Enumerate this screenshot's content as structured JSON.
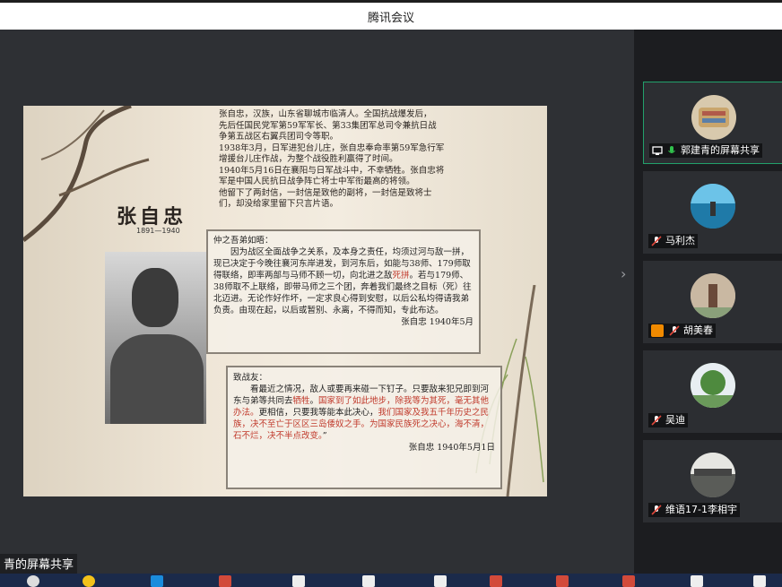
{
  "window": {
    "title": "腾讯会议"
  },
  "stage": {
    "share_label": "青的屏幕共享"
  },
  "slide": {
    "name": "张自忠",
    "dates": "1891—1940",
    "bio_lines": [
      "张自忠，汉族，山东省聊城市临清人。全国抗战爆发后，",
      "先后任国民党军第59军军长、第33集团军总司令兼抗日战",
      "争第五战区右翼兵团司令等职。",
      "1938年3月，日军进犯台儿庄，张自忠奉命率第59军急行军",
      "增援台儿庄作战，为整个战役胜利赢得了时间。",
      "1940年5月16日在襄阳与日军战斗中，不幸牺牲。张自忠将",
      "军是中国人民抗日战争阵亡将士中军衔最高的将领。",
      "他留下了两封信，一封信是致他的副将，一封信是致将士",
      "们，却没给家里留下只言片语。"
    ],
    "letter1": {
      "greeting": "仲之吾弟如晤：",
      "body_a": "因为战区全面战争之关系，及本身之责任，均须过河与敌一拼，现已决定于今晚往襄河东岸进发，到河东后，如能与38师、179师取得联络，即率两部与马师不顾一切，向北进之敌",
      "body_red": "死拼",
      "body_b": "。若与179师、38师取不上联络，即带马师之三个团，奔着我们最终之目标（死）往北迈进。无论作好作坏，一定求良心得到安慰，以后公私均得请我弟负责。由现在起，以后或暂别、永离，不得而知，专此布达。",
      "signature": "张自忠 1940年5月"
    },
    "letter2": {
      "greeting": "致战友：",
      "body_a": "看最近之情况，敌人或要再来碰一下钉子。只要敌来犯兄即到河东与弟等共同去",
      "body_red1": "牺牲",
      "body_b": "。",
      "body_red2": "国家到了如此地步，除我等为其死，毫无其他办法。",
      "body_c": "更相信，只要我等能本此决心，",
      "body_red3": "我们国家及我五千年历史之民族，决不至亡于区区三岛倭奴之手。为国家民族死之决心，海不清，石不烂，决不半点改变。",
      "body_d": "”",
      "signature": "张自忠 1940年5月1日"
    }
  },
  "participants": [
    {
      "name": "郭建青的屏幕共享",
      "active": true,
      "avatar_color": "#d8c9ad",
      "status_icons": [
        "screen-share-icon",
        "mic-on-icon"
      ]
    },
    {
      "name": "马利杰",
      "active": false,
      "avatar_color": "#2d8fb8",
      "status_icons": [
        "mic-muted-icon"
      ]
    },
    {
      "name": "胡美春",
      "active": false,
      "avatar_color": "#b7b0a3",
      "status_icons": [
        "user-badge-icon",
        "mic-muted-icon"
      ]
    },
    {
      "name": "吴迪",
      "active": false,
      "avatar_color": "#5f8f57",
      "status_icons": [
        "mic-muted-icon"
      ]
    },
    {
      "name": "维语17-1李相宇",
      "active": false,
      "avatar_color": "#9a9c98",
      "status_icons": [
        "mic-muted-icon"
      ]
    }
  ],
  "colors": {
    "accent_active": "#22a06b",
    "muted_red": "#e0473a",
    "mic_green": "#31c24d",
    "letter_red": "#c0392b"
  }
}
